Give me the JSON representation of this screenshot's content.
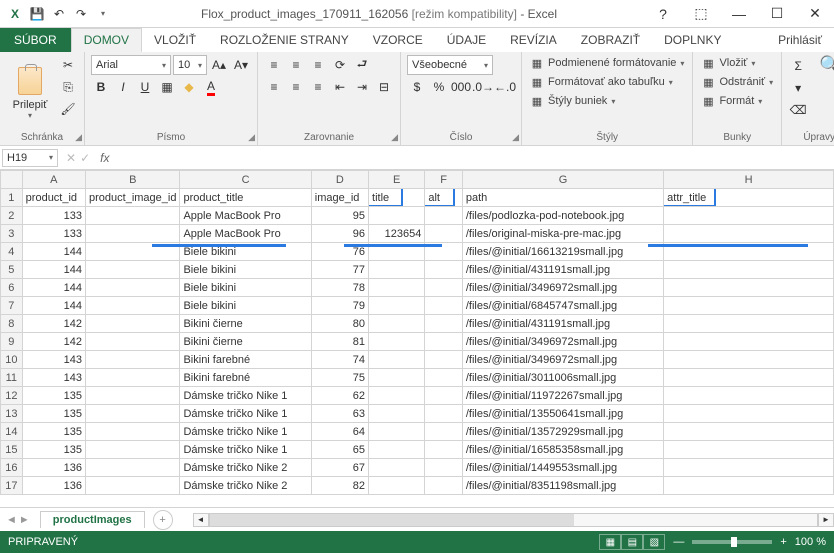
{
  "titlebar": {
    "doc": "Flox_product_images_170911_162056",
    "mode": "[režim kompatibility]",
    "app": "Excel"
  },
  "tabs": {
    "file": "SÚBOR",
    "home": "DOMOV",
    "insert": "VLOŽIŤ",
    "layout": "ROZLOŽENIE STRANY",
    "formulas": "VZORCE",
    "data": "ÚDAJE",
    "review": "REVÍZIA",
    "view": "ZOBRAZIŤ",
    "addins": "DOPLNKY",
    "signin": "Prihlásiť"
  },
  "ribbon": {
    "clipboard": {
      "paste": "Prilepiť",
      "label": "Schránka"
    },
    "font": {
      "name": "Arial",
      "size": "10",
      "label": "Písmo"
    },
    "align": {
      "label": "Zarovnanie"
    },
    "number": {
      "format": "Všeobecné",
      "label": "Číslo"
    },
    "styles": {
      "cond": "Podmienené formátovanie",
      "table": "Formátovať ako tabuľku",
      "cell": "Štýly buniek",
      "label": "Štýly"
    },
    "cells": {
      "insert": "Vložiť",
      "delete": "Odstrániť",
      "format": "Formát",
      "label": "Bunky"
    },
    "editing": {
      "label": "Úpravy"
    }
  },
  "formula": {
    "cell": "H19",
    "value": ""
  },
  "cols": [
    "",
    "A",
    "B",
    "C",
    "D",
    "E",
    "F",
    "G",
    "H"
  ],
  "headers": {
    "a": "product_id",
    "b": "product_image_id",
    "c": "product_title",
    "d": "image_id",
    "e": "title",
    "f": "alt",
    "g": "path",
    "h": "attr_title"
  },
  "rows": [
    {
      "n": "2",
      "a": "133",
      "c": "Apple MacBook Pro",
      "d": "95",
      "e": "",
      "g": "/files/podlozka-pod-notebook.jpg"
    },
    {
      "n": "3",
      "a": "133",
      "c": "Apple MacBook Pro",
      "d": "96",
      "e": "123654",
      "g": "/files/original-miska-pre-mac.jpg"
    },
    {
      "n": "4",
      "a": "144",
      "c": "Biele bikini",
      "d": "76",
      "e": "",
      "g": "/files/@initial/16613219small.jpg"
    },
    {
      "n": "5",
      "a": "144",
      "c": "Biele bikini",
      "d": "77",
      "e": "",
      "g": "/files/@initial/431191small.jpg"
    },
    {
      "n": "6",
      "a": "144",
      "c": "Biele bikini",
      "d": "78",
      "e": "",
      "g": "/files/@initial/3496972small.jpg"
    },
    {
      "n": "7",
      "a": "144",
      "c": "Biele bikini",
      "d": "79",
      "e": "",
      "g": "/files/@initial/6845747small.jpg"
    },
    {
      "n": "8",
      "a": "142",
      "c": "Bikini čierne",
      "d": "80",
      "e": "",
      "g": "/files/@initial/431191small.jpg"
    },
    {
      "n": "9",
      "a": "142",
      "c": "Bikini čierne",
      "d": "81",
      "e": "",
      "g": "/files/@initial/3496972small.jpg"
    },
    {
      "n": "10",
      "a": "143",
      "c": "Bikini farebné",
      "d": "74",
      "e": "",
      "g": "/files/@initial/3496972small.jpg"
    },
    {
      "n": "11",
      "a": "143",
      "c": "Bikini farebné",
      "d": "75",
      "e": "",
      "g": "/files/@initial/3011006small.jpg"
    },
    {
      "n": "12",
      "a": "135",
      "c": "Dámske tričko Nike 1",
      "d": "62",
      "e": "",
      "g": "/files/@initial/11972267small.jpg"
    },
    {
      "n": "13",
      "a": "135",
      "c": "Dámske tričko Nike 1",
      "d": "63",
      "e": "",
      "g": "/files/@initial/13550641small.jpg"
    },
    {
      "n": "14",
      "a": "135",
      "c": "Dámske tričko Nike 1",
      "d": "64",
      "e": "",
      "g": "/files/@initial/13572929small.jpg"
    },
    {
      "n": "15",
      "a": "135",
      "c": "Dámske tričko Nike 1",
      "d": "65",
      "e": "",
      "g": "/files/@initial/16585358small.jpg"
    },
    {
      "n": "16",
      "a": "136",
      "c": "Dámske tričko Nike 2",
      "d": "67",
      "e": "",
      "g": "/files/@initial/1449553small.jpg"
    },
    {
      "n": "17",
      "a": "136",
      "c": "Dámske tričko Nike 2",
      "d": "82",
      "e": "",
      "g": "/files/@initial/8351198small.jpg"
    }
  ],
  "sheet": {
    "name": "productImages"
  },
  "status": {
    "ready": "PRIPRAVENÝ",
    "zoom": "100 %"
  }
}
